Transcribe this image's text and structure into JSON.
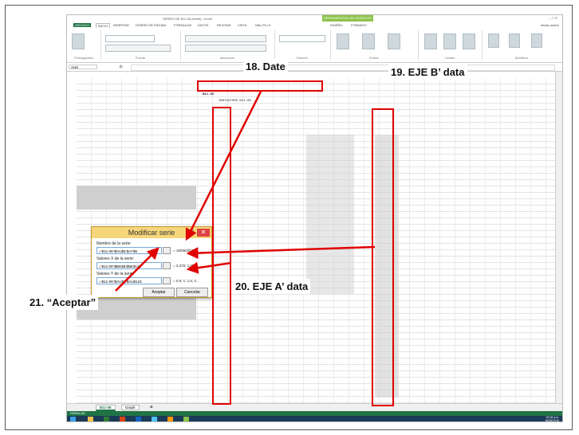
{
  "app": {
    "window_title": "SERIES DE B11-06 (sheet) - Excel",
    "context_tab": "HERRAMIENTAS DE GRÁFICOS",
    "user_label": "Iniciar sesión"
  },
  "ribbon": {
    "tabs": [
      "ARCHIVO",
      "INICIO",
      "INSERTAR",
      "DISEÑO DE PÁGINA",
      "FÓRMULAS",
      "DATOS",
      "REVISAR",
      "VISTA",
      "Nitro Pro 9",
      "DISEÑO",
      "FORMATO"
    ],
    "active_tab": "INICIO",
    "groups": [
      "Portapapeles",
      "Fuente",
      "Alineación",
      "Número",
      "Estilos",
      "Celdas",
      "Modificar"
    ]
  },
  "formula_bar": {
    "name_box": "AU5",
    "fx": "fx",
    "content": ""
  },
  "sheet": {
    "title_lines": [
      "B11-06",
      "INDICATORS B11-06"
    ],
    "tabs": [
      "B11-06",
      "Graph"
    ],
    "active_tab": "B11-06",
    "status": "SEÑALAR"
  },
  "dialog": {
    "title": "Modificar serie",
    "help": "?",
    "close": "✕",
    "name_label": "Nombre de la serie:",
    "name_value": "='B11-06'!$AU$5:$AY$5",
    "name_preview": "= 18/06/2015",
    "x_label": "Valores X de la serie:",
    "x_value": "='B11-06'!$BE$8:$BE$123",
    "x_preview": "= 3,375; 1,05; 0,...",
    "y_label": "Valores Y de la serie:",
    "y_value": "='B11-06'!$AU$8:$AU$123",
    "y_preview": "= 0,5; 1; 1,5; 2...",
    "ok": "Aceptar",
    "cancel": "Cancelar"
  },
  "annotations": {
    "date": "18. Date",
    "eje_b": "19. EJE B’ data",
    "eje_a": "20. EJE A’ data",
    "aceptar": "21. “Aceptar”",
    "color": "#e00000"
  },
  "taskbar": {
    "time": "09:48 a.m.",
    "date": "18/06/2015"
  }
}
